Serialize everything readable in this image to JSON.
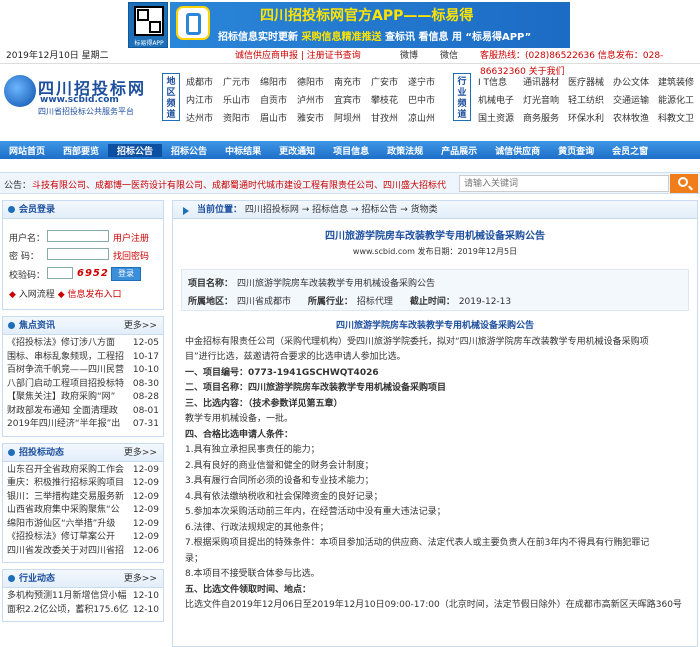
{
  "banner": {
    "qr_label": "标易得APP",
    "title": "四川招投标网官方APP——标易得",
    "subtitle_prefix": "招标信息实时更新",
    "subtitle_mid": "采购信息精准推送",
    "subtitle_tail1": "查标讯",
    "subtitle_tail2": "看信息",
    "subtitle_tail3": "用",
    "subtitle_brand": "“标易得APP”"
  },
  "infobar": {
    "date": "2019年12月10日 星期二",
    "links": "诚信供应商申报 | 注册证书查询",
    "weibo": "微博",
    "wechat": "微信",
    "tel": "客服热线：(028)86522636 信息发布：028-86632360 关于我们"
  },
  "logo": {
    "name": "四川招投标网",
    "url": "www.scbid.com",
    "sub": "四川省招投标公共服务平台"
  },
  "region": {
    "label": "地区频道",
    "items": [
      "成都市",
      "广元市",
      "绵阳市",
      "德阳市",
      "南充市",
      "广安市",
      "遂宁市",
      "内江市",
      "乐山市",
      "自贡市",
      "泸州市",
      "宜宾市",
      "攀枝花",
      "巴中市",
      "达州市",
      "资阳市",
      "眉山市",
      "雅安市",
      "阿坝州",
      "甘孜州",
      "凉山州"
    ]
  },
  "industry": {
    "label": "行业频道",
    "items": [
      "I T信息",
      "通讯器材",
      "医疗器械",
      "办公文体",
      "建筑装修",
      "机械电子",
      "灯光音响",
      "轻工纺织",
      "交通运输",
      "能源化工",
      "国土资源",
      "商务服务",
      "环保水利",
      "农林牧渔",
      "科教文卫"
    ]
  },
  "nav": [
    "网站首页",
    "西部要览",
    "招标公告",
    "招标公告",
    "中标结果",
    "更改通知",
    "项目信息",
    "政策法规",
    "产品展示",
    "诚信供应商",
    "黄页查询",
    "会员之窗"
  ],
  "notice": {
    "label": "公告：",
    "text": "斗技有限公司、成都博一医药设计有限公司、成都蜀通时代城市建设工程有限责任公司、四川盛大招标代",
    "search_placeholder": "请输入关键词"
  },
  "login": {
    "title": "会员登录",
    "user_label": "用户名：",
    "pass_label": "密 码：",
    "code_label": "校验码：",
    "register": "用户注册",
    "forgot": "找回密码",
    "code": "6952",
    "login_btn": "登录",
    "flow": "入网流程",
    "report": "信息发布入口"
  },
  "focus": {
    "title": "焦点资讯",
    "more": "更多>>",
    "items": [
      [
        "《招投标法》修订涉八方面",
        "12-05"
      ],
      [
        "围标、串标乱象频现，工程招",
        "10-17"
      ],
      [
        "百树争流千帆竞——四川民营",
        "10-10"
      ],
      [
        "八部门启动工程项目招投标特",
        "08-30"
      ],
      [
        "【聚焦关注】政府采购“网”",
        "08-28"
      ],
      [
        "财政部发布通知 全面清理政",
        "08-01"
      ],
      [
        "2019年四川经济“半年报”出",
        "07-31"
      ]
    ]
  },
  "tender": {
    "title": "招投标动态",
    "more": "更多>>",
    "items": [
      [
        "山东召开全省政府采购工作会",
        "12-09"
      ],
      [
        "重庆：积极推行招标采购项目",
        "12-09"
      ],
      [
        "银川：三举措构建交易服务新",
        "12-09"
      ],
      [
        "山西省政府集中采购聚焦“公",
        "12-09"
      ],
      [
        "绵阳市游仙区“六举措”升级",
        "12-09"
      ],
      [
        "《招投标法》修订草案公开",
        "12-09"
      ],
      [
        "四川省发改委关于对四川省招",
        "12-06"
      ]
    ]
  },
  "industry_news": {
    "title": "行业动态",
    "more": "更多>>",
    "items": [
      [
        "多机构预测11月新增信贷小幅",
        "12-10"
      ],
      [
        "面积2.2亿公顷，蓄积175.6亿",
        "12-10"
      ]
    ]
  },
  "crumb": {
    "here": "当前位置：",
    "path": "四川招投标网 → 招标信息 → 招标公告 → 货物类"
  },
  "article": {
    "title": "四川旅游学院房车改装教学专用机械设备采购公告",
    "meta": "www.scbid.com   发布日期：2019年12月5日",
    "proj_label": "项目名称：",
    "proj": "四川旅游学院房车改装教学专用机械设备采购公告",
    "area_label": "所属地区：",
    "area": "四川省成都市",
    "ind_label": "所属行业：",
    "ind": "招标代理",
    "due_label": "截止时间：",
    "due": "2019-12-13",
    "heading": "四川旅游学院房车改装教学专用机械设备采购公告",
    "lines": [
      "中金招标有限责任公司（采购代理机构）受四川旅游学院委托，拟对“四川旅游学院房车改装教学专用机械设备采购项",
      "目”进行比选，兹邀请符合要求的比选申请人参加比选。",
      "一、项目编号：0773-1941GSCHWQT4026",
      "二、项目名称：四川旅游学院房车改装教学专用机械设备采购项目",
      "三、比选内容：（技术参数详见第五章）",
      "教学专用机械设备，一批。",
      "四、合格比选申请人条件：",
      "1.具有独立承担民事责任的能力；",
      "2.具有良好的商业信誉和健全的财务会计制度；",
      "3.具有履行合同所必须的设备和专业技术能力；",
      "4.具有依法缴纳税收和社会保障资金的良好记录；",
      "5.参加本次采购活动前三年内，在经营活动中没有重大违法记录；",
      "6.法律、行政法规规定的其他条件；",
      "7.根据采购项目提出的特殊条件：本项目参加活动的供应商、法定代表人或主要负责人在前3年内不得具有行贿犯罪记",
      "录；",
      "8.本项目不接受联合体参与比选。",
      "五、比选文件领取时间、地点：",
      "比选文件自2019年12月06日至2019年12月10日09:00-17:00（北京时间，法定节假日除外）在成都市高新区天晖路360号"
    ]
  },
  "colors": {
    "accent": "#1d6fb8",
    "nav": "#2a7fd4",
    "red": "#cc0000",
    "orange": "#f07c1a"
  }
}
